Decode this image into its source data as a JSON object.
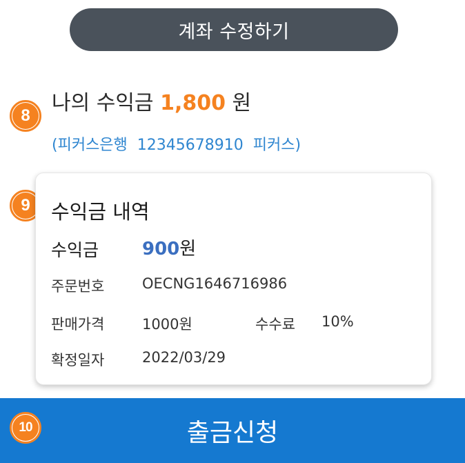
{
  "edit_account_button": "계좌 수정하기",
  "badges": [
    "8",
    "9",
    "10"
  ],
  "earnings": {
    "prefix": "나의 수익금 ",
    "amount": "1,800",
    "suffix": " 원"
  },
  "bank_info": "(피커스은행  12345678910  피커스)",
  "history": {
    "title": "수익금 내역",
    "earn_label": "수익금",
    "earn_amount": "900",
    "earn_unit": "원",
    "order_label": "주문번호",
    "order_value": "OECNG1646716986",
    "price_label": "판매가격",
    "price_value": "1000원",
    "fee_label": "수수료",
    "fee_value": "10%",
    "date_label": "확정일자",
    "date_value": "2022/03/29"
  },
  "withdraw_button": "출금신청",
  "colors": {
    "accent_orange": "#f58220",
    "link_blue": "#2f86d0",
    "primary_blue": "#1579d0",
    "dark_button": "#4a525b"
  }
}
